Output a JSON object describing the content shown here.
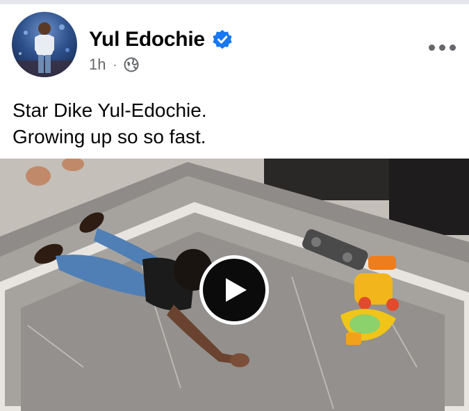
{
  "post": {
    "author": "Yul Edochie",
    "verified": true,
    "time": "1h",
    "separator": "·",
    "audience_icon": "globe-icon",
    "more_icon": "more-options-icon",
    "text_lines": [
      "Star Dike Yul-Edochie.",
      "Growing up so so fast."
    ]
  },
  "video": {
    "play_icon": "play-icon"
  },
  "colors": {
    "verified_blue": "#1877f2",
    "secondary_text": "#65676b",
    "primary_text": "#050505"
  }
}
